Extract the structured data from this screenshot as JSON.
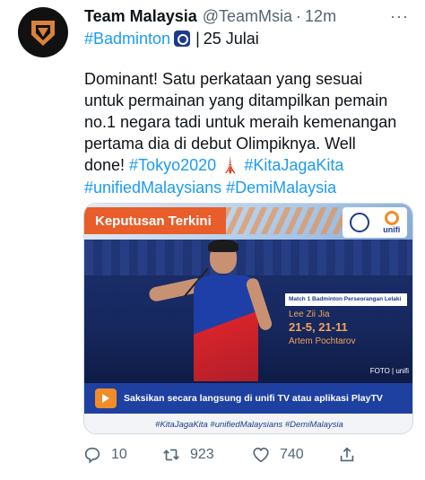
{
  "author": {
    "name": "Team Malaysia",
    "handle": "@TeamMsia",
    "dot": "·",
    "time": "12m",
    "avatar_icon": "team-malaysia-logo-icon",
    "more_icon": "more-icon",
    "more_label": "···"
  },
  "tagline": {
    "hashtag": "#Badminton",
    "sport_icon": "badminton-icon",
    "separator": "|",
    "date": "25 Julai"
  },
  "tweet": {
    "line1": "Dominant! Satu perkataan yang sesuai",
    "line2": "untuk permainan yang ditampilkan pemain",
    "line3": "no.1 negara tadi untuk meraih kemenangan",
    "line4": "pertama dia di debut Olimpiknya. Well",
    "line5_text": "done! ",
    "tag_tokyo": "#Tokyo2020",
    "tower_emoji": "🗼",
    "tag_kita": "#KitaJagaKita",
    "tag_unified": "#unifiedMalaysians",
    "tag_demi": "#DemiMalaysia"
  },
  "card": {
    "headline": "Keputusan Terkini",
    "logo_unifi": "unifi",
    "match_label": "Match 1 Badminton Perseorangan Lelaki",
    "winner": "Lee Zii Jia",
    "score": "21-5, 21-11",
    "loser": "Artem Pochtarov",
    "credit": "FOTO | unifi",
    "promo": "Saksikan secara langsung di unifi TV atau aplikasi PlayTV",
    "footer_tags": "#KitaJagaKita  #unifiedMalaysians  #DemiMalaysia"
  },
  "actions": {
    "replies": "10",
    "retweets": "923",
    "likes": "740",
    "reply_icon": "reply-icon",
    "retweet_icon": "retweet-icon",
    "like_icon": "heart-icon",
    "share_icon": "share-icon"
  },
  "colors": {
    "link": "#1d9bf0",
    "muted": "#536471",
    "text": "#0f1419",
    "headline_orange": "#e85d2a",
    "promo_blue": "#1e40a0"
  }
}
